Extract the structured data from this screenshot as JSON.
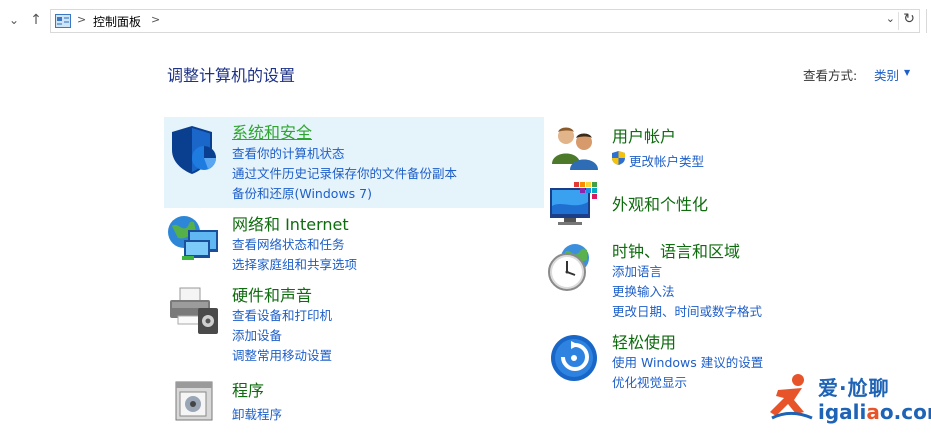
{
  "address_bar": {
    "path": "控制面板",
    "separator": ">"
  },
  "header": {
    "title": "调整计算机的设置",
    "view_by_label": "查看方式:",
    "view_by_value": "类别"
  },
  "left_categories": [
    {
      "title": "系统和安全",
      "links": [
        "查看你的计算机状态",
        "通过文件历史记录保存你的文件备份副本",
        "备份和还原(Windows 7)"
      ]
    },
    {
      "title": "网络和 Internet",
      "links": [
        "查看网络状态和任务",
        "选择家庭组和共享选项"
      ]
    },
    {
      "title": "硬件和声音",
      "links": [
        "查看设备和打印机",
        "添加设备",
        "调整常用移动设置"
      ]
    },
    {
      "title": "程序",
      "links": [
        "卸载程序"
      ]
    }
  ],
  "right_categories": [
    {
      "title": "用户帐户",
      "links": [
        "更改帐户类型"
      ]
    },
    {
      "title": "外观和个性化",
      "links": []
    },
    {
      "title": "时钟、语言和区域",
      "links": [
        "添加语言",
        "更换输入法",
        "更改日期、时间或数字格式"
      ]
    },
    {
      "title": "轻松使用",
      "links": [
        "使用 Windows 建议的设置",
        "优化视觉显示"
      ]
    }
  ],
  "watermark": {
    "cn_text": "爱·尬聊",
    "url_prefix": "igali",
    "url_o": "a",
    "url_suffix": "o.com"
  },
  "colors": {
    "title_blue": "#1e3287",
    "link_blue": "#1e5fc8",
    "category_green": "#0e6b0e",
    "highlight_bg": "#e5f3fb"
  }
}
